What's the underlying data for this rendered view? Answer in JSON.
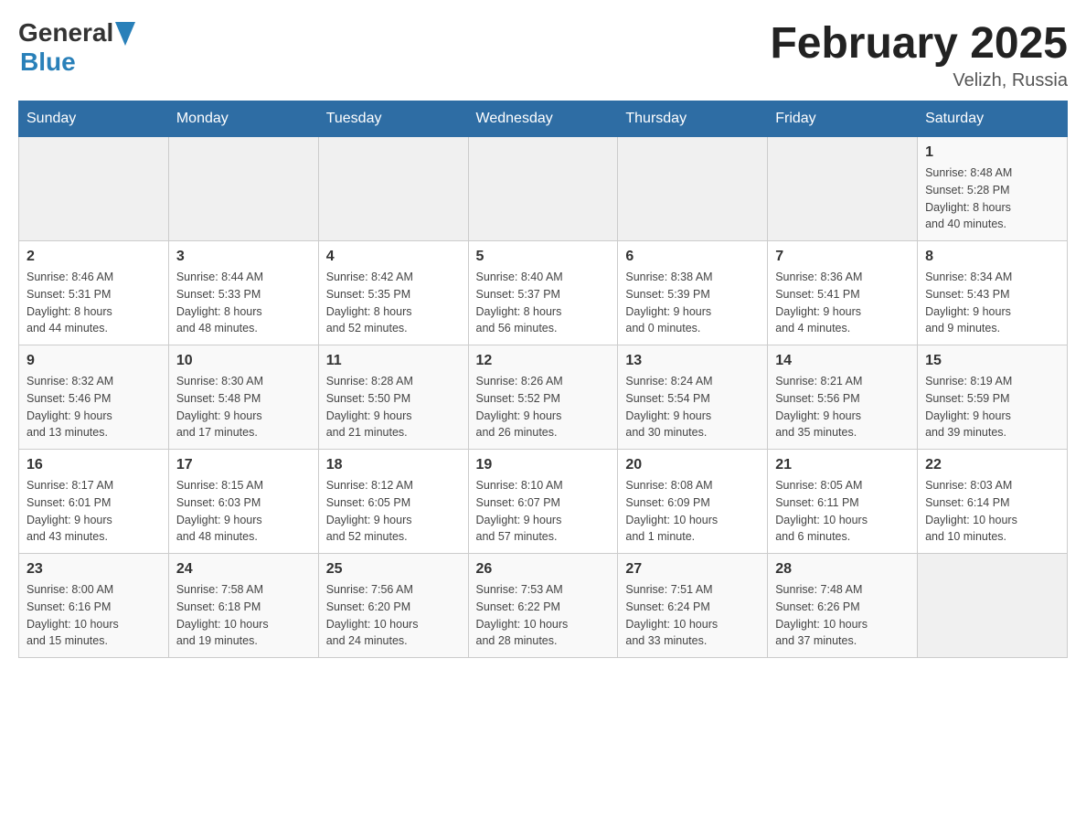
{
  "header": {
    "logo_general": "General",
    "logo_blue": "Blue",
    "month_title": "February 2025",
    "location": "Velizh, Russia"
  },
  "weekdays": [
    "Sunday",
    "Monday",
    "Tuesday",
    "Wednesday",
    "Thursday",
    "Friday",
    "Saturday"
  ],
  "weeks": [
    [
      {
        "day": "",
        "info": ""
      },
      {
        "day": "",
        "info": ""
      },
      {
        "day": "",
        "info": ""
      },
      {
        "day": "",
        "info": ""
      },
      {
        "day": "",
        "info": ""
      },
      {
        "day": "",
        "info": ""
      },
      {
        "day": "1",
        "info": "Sunrise: 8:48 AM\nSunset: 5:28 PM\nDaylight: 8 hours\nand 40 minutes."
      }
    ],
    [
      {
        "day": "2",
        "info": "Sunrise: 8:46 AM\nSunset: 5:31 PM\nDaylight: 8 hours\nand 44 minutes."
      },
      {
        "day": "3",
        "info": "Sunrise: 8:44 AM\nSunset: 5:33 PM\nDaylight: 8 hours\nand 48 minutes."
      },
      {
        "day": "4",
        "info": "Sunrise: 8:42 AM\nSunset: 5:35 PM\nDaylight: 8 hours\nand 52 minutes."
      },
      {
        "day": "5",
        "info": "Sunrise: 8:40 AM\nSunset: 5:37 PM\nDaylight: 8 hours\nand 56 minutes."
      },
      {
        "day": "6",
        "info": "Sunrise: 8:38 AM\nSunset: 5:39 PM\nDaylight: 9 hours\nand 0 minutes."
      },
      {
        "day": "7",
        "info": "Sunrise: 8:36 AM\nSunset: 5:41 PM\nDaylight: 9 hours\nand 4 minutes."
      },
      {
        "day": "8",
        "info": "Sunrise: 8:34 AM\nSunset: 5:43 PM\nDaylight: 9 hours\nand 9 minutes."
      }
    ],
    [
      {
        "day": "9",
        "info": "Sunrise: 8:32 AM\nSunset: 5:46 PM\nDaylight: 9 hours\nand 13 minutes."
      },
      {
        "day": "10",
        "info": "Sunrise: 8:30 AM\nSunset: 5:48 PM\nDaylight: 9 hours\nand 17 minutes."
      },
      {
        "day": "11",
        "info": "Sunrise: 8:28 AM\nSunset: 5:50 PM\nDaylight: 9 hours\nand 21 minutes."
      },
      {
        "day": "12",
        "info": "Sunrise: 8:26 AM\nSunset: 5:52 PM\nDaylight: 9 hours\nand 26 minutes."
      },
      {
        "day": "13",
        "info": "Sunrise: 8:24 AM\nSunset: 5:54 PM\nDaylight: 9 hours\nand 30 minutes."
      },
      {
        "day": "14",
        "info": "Sunrise: 8:21 AM\nSunset: 5:56 PM\nDaylight: 9 hours\nand 35 minutes."
      },
      {
        "day": "15",
        "info": "Sunrise: 8:19 AM\nSunset: 5:59 PM\nDaylight: 9 hours\nand 39 minutes."
      }
    ],
    [
      {
        "day": "16",
        "info": "Sunrise: 8:17 AM\nSunset: 6:01 PM\nDaylight: 9 hours\nand 43 minutes."
      },
      {
        "day": "17",
        "info": "Sunrise: 8:15 AM\nSunset: 6:03 PM\nDaylight: 9 hours\nand 48 minutes."
      },
      {
        "day": "18",
        "info": "Sunrise: 8:12 AM\nSunset: 6:05 PM\nDaylight: 9 hours\nand 52 minutes."
      },
      {
        "day": "19",
        "info": "Sunrise: 8:10 AM\nSunset: 6:07 PM\nDaylight: 9 hours\nand 57 minutes."
      },
      {
        "day": "20",
        "info": "Sunrise: 8:08 AM\nSunset: 6:09 PM\nDaylight: 10 hours\nand 1 minute."
      },
      {
        "day": "21",
        "info": "Sunrise: 8:05 AM\nSunset: 6:11 PM\nDaylight: 10 hours\nand 6 minutes."
      },
      {
        "day": "22",
        "info": "Sunrise: 8:03 AM\nSunset: 6:14 PM\nDaylight: 10 hours\nand 10 minutes."
      }
    ],
    [
      {
        "day": "23",
        "info": "Sunrise: 8:00 AM\nSunset: 6:16 PM\nDaylight: 10 hours\nand 15 minutes."
      },
      {
        "day": "24",
        "info": "Sunrise: 7:58 AM\nSunset: 6:18 PM\nDaylight: 10 hours\nand 19 minutes."
      },
      {
        "day": "25",
        "info": "Sunrise: 7:56 AM\nSunset: 6:20 PM\nDaylight: 10 hours\nand 24 minutes."
      },
      {
        "day": "26",
        "info": "Sunrise: 7:53 AM\nSunset: 6:22 PM\nDaylight: 10 hours\nand 28 minutes."
      },
      {
        "day": "27",
        "info": "Sunrise: 7:51 AM\nSunset: 6:24 PM\nDaylight: 10 hours\nand 33 minutes."
      },
      {
        "day": "28",
        "info": "Sunrise: 7:48 AM\nSunset: 6:26 PM\nDaylight: 10 hours\nand 37 minutes."
      },
      {
        "day": "",
        "info": ""
      }
    ]
  ]
}
